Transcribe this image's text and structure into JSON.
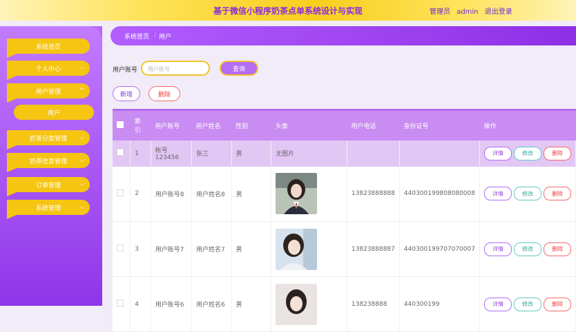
{
  "header": {
    "title": "基于微信小程序奶茶点单系统设计与实现",
    "role": "管理员",
    "username": "admin",
    "logout": "退出登录"
  },
  "sidebar": {
    "items": [
      {
        "label": "系统首页"
      },
      {
        "label": "个人中心"
      },
      {
        "label": "用户管理"
      },
      {
        "label": "用户"
      },
      {
        "label": "奶茶分类管理"
      },
      {
        "label": "奶茶信息管理"
      },
      {
        "label": "订单管理"
      },
      {
        "label": "系统管理"
      }
    ]
  },
  "breadcrumb": {
    "home": "系统首页",
    "sep": ":",
    "current": "用户"
  },
  "search": {
    "label": "用户账号",
    "placeholder": "用户账号",
    "button": "查询"
  },
  "actions": {
    "add": "新增",
    "delete": "删除"
  },
  "table": {
    "headers": [
      "索引",
      "用户账号",
      "用户姓名",
      "性别",
      "头像",
      "用户电话",
      "身份证号",
      "操作"
    ],
    "no_image": "无图片",
    "row_actions": {
      "detail": "详情",
      "edit": "修改",
      "delete": "删除"
    },
    "rows": [
      {
        "index": "1",
        "account": "帐号123456",
        "name": "张三",
        "gender": "男",
        "phone": "",
        "id_card": ""
      },
      {
        "index": "2",
        "account": "用户账号8",
        "name": "用户姓名8",
        "gender": "男",
        "phone": "13823888888",
        "id_card": "440300199808080008"
      },
      {
        "index": "3",
        "account": "用户账号7",
        "name": "用户姓名7",
        "gender": "男",
        "phone": "13823888887",
        "id_card": "440300199707070007"
      },
      {
        "index": "4",
        "account": "用户账号6",
        "name": "用户姓名6",
        "gender": "男",
        "phone": "138238888",
        "id_card": "440300199"
      }
    ]
  }
}
